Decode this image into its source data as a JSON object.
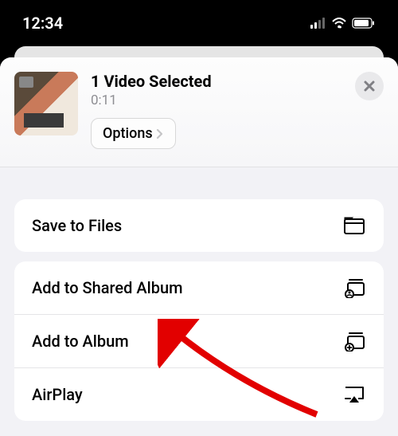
{
  "status": {
    "time": "12:34"
  },
  "header": {
    "title": "1 Video Selected",
    "duration": "0:11",
    "options_label": "Options"
  },
  "actions": {
    "save_to_files": "Save to Files",
    "add_to_shared_album": "Add to Shared Album",
    "add_to_album": "Add to Album",
    "airplay": "AirPlay"
  }
}
